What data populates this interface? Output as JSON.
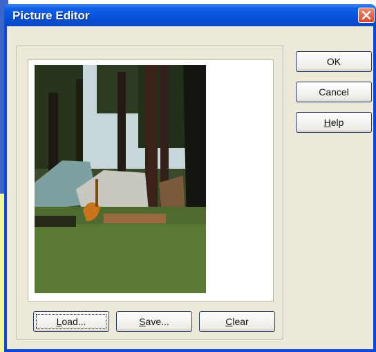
{
  "window": {
    "title": "Picture Editor"
  },
  "buttons": {
    "ok": "OK",
    "cancel": "Cancel",
    "help_first": "H",
    "help_rest": "elp",
    "load_first": "L",
    "load_rest": "oad...",
    "save_first": "S",
    "save_rest": "ave...",
    "clear_first": "C",
    "clear_rest": "lear"
  },
  "icons": {
    "close": "close-icon"
  },
  "colors": {
    "titlebar": "#0752d8",
    "client_bg": "#ece9d8",
    "close_button": "#d9482a"
  }
}
